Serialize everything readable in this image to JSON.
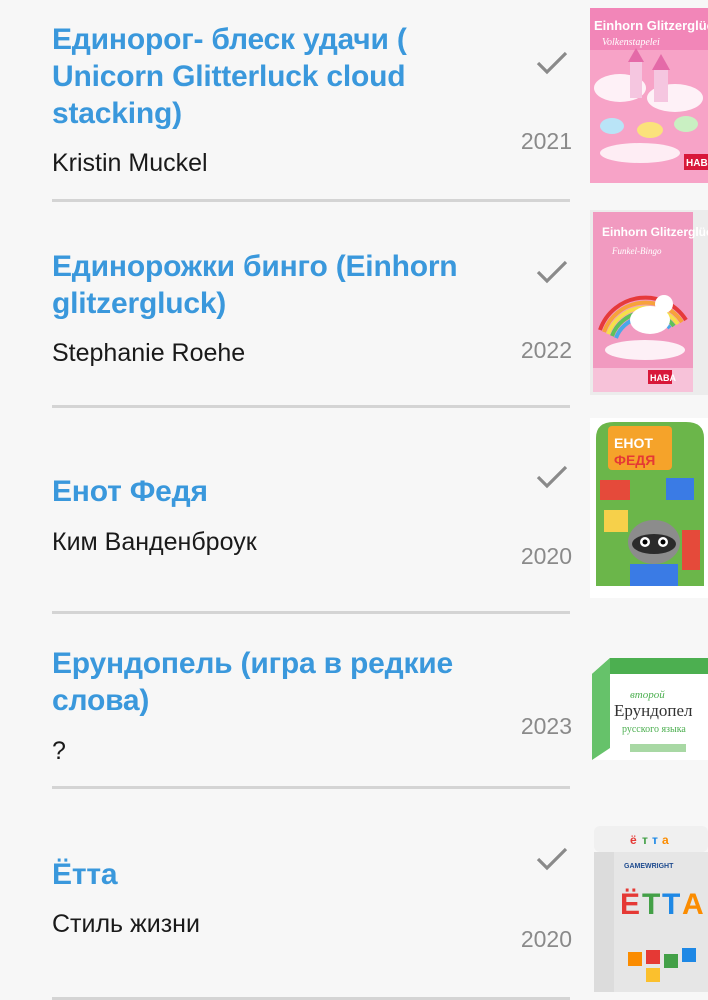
{
  "games": [
    {
      "title": "Единорог- блеск удачи ( Unicorn Glitterluck cloud stacking)",
      "author": "Kristin Muckel",
      "year": "2021",
      "checked": true,
      "cover": {
        "icon": "unicorn-glitterluck-box",
        "brand_text": "Einhorn Glitzerglück",
        "subtitle_text": "Volkenstapelei",
        "publisher": "HABA",
        "bg": "#f7a3c7"
      }
    },
    {
      "title": "Единорожки бинго (Einhorn glitzergluck)",
      "author": "Stephanie Roehe",
      "year": "2022",
      "checked": true,
      "cover": {
        "icon": "unicorn-bingo-box",
        "brand_text": "Einhorn Glitzerglück",
        "subtitle_text": "Funkel-Bingo",
        "publisher": "HABA",
        "bg": "#f19ac0"
      }
    },
    {
      "title": "Енот Федя",
      "author": "Ким Ванденброук",
      "year": "2020",
      "checked": true,
      "cover": {
        "icon": "raccoon-box",
        "brand_text": "ЕНОТ ФЕДЯ",
        "bg": "#6bb64a"
      }
    },
    {
      "title": "Ерундопель (игра в редкие слова)",
      "author": "?",
      "year": "2023",
      "checked": false,
      "cover": {
        "icon": "erundopel-box",
        "brand_text": "Ерундопел",
        "top_text": "второй",
        "bottom_text": "русского языка",
        "bg": "#ffffff"
      }
    },
    {
      "title": "Ётта",
      "author": "Стиль жизни",
      "year": "2020",
      "checked": true,
      "cover": {
        "icon": "yotta-tin-box",
        "brand_text": "ЁТТА",
        "publisher": "GAMEWRIGHT",
        "bg": "#eaeaea"
      }
    }
  ],
  "colors": {
    "title": "#3a98dc",
    "author": "#1a1a1a",
    "year": "#8a8a8a",
    "check": "#8a8a8a",
    "divider": "#d4d4d4",
    "background": "#f7f7f7"
  }
}
